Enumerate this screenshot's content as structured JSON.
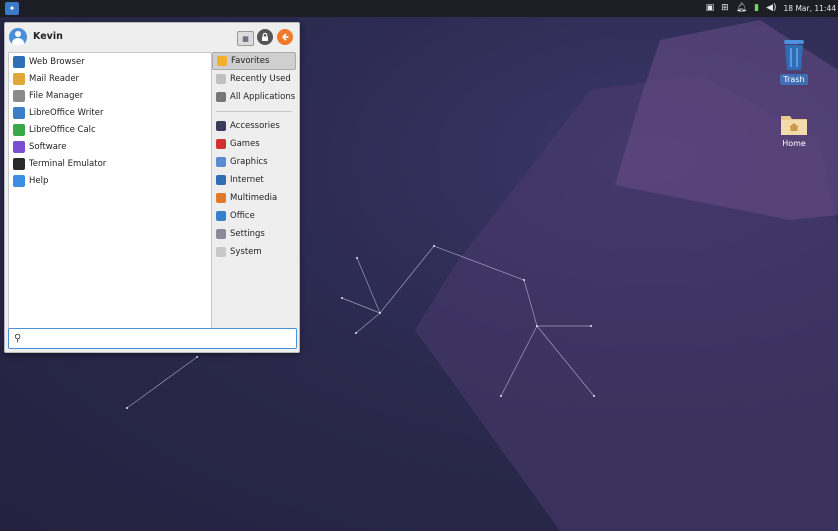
{
  "panel": {
    "clock": "18 Mar, 11:44"
  },
  "menu": {
    "username": "Kevin",
    "favorites": [
      {
        "label": "Web Browser",
        "icon": "globe-icon",
        "color": "#2f6db5"
      },
      {
        "label": "Mail Reader",
        "icon": "mail-icon",
        "color": "#e0a83a"
      },
      {
        "label": "File Manager",
        "icon": "folder-icon",
        "color": "#8a8a8a"
      },
      {
        "label": "LibreOffice Writer",
        "icon": "writer-icon",
        "color": "#3a7fc8"
      },
      {
        "label": "LibreOffice Calc",
        "icon": "calc-icon",
        "color": "#3aa84a"
      },
      {
        "label": "Software",
        "icon": "software-icon",
        "color": "#7b4fd1"
      },
      {
        "label": "Terminal Emulator",
        "icon": "terminal-icon",
        "color": "#2a2a2a"
      },
      {
        "label": "Help",
        "icon": "help-icon",
        "color": "#3a8fe0"
      }
    ],
    "categories_top": [
      {
        "label": "Favorites",
        "icon": "star-icon",
        "color": "#f0b030",
        "selected": true
      },
      {
        "label": "Recently Used",
        "icon": "clock-icon",
        "color": "#c0c0c0",
        "selected": false
      },
      {
        "label": "All Applications",
        "icon": "apps-icon",
        "color": "#777777",
        "selected": false
      }
    ],
    "categories": [
      {
        "label": "Accessories",
        "icon": "accessories-icon",
        "color": "#3a3a5a"
      },
      {
        "label": "Games",
        "icon": "games-icon",
        "color": "#d03030"
      },
      {
        "label": "Graphics",
        "icon": "graphics-icon",
        "color": "#5a8ad0"
      },
      {
        "label": "Internet",
        "icon": "internet-icon",
        "color": "#2f6db5"
      },
      {
        "label": "Multimedia",
        "icon": "multimedia-icon",
        "color": "#e07a2a"
      },
      {
        "label": "Office",
        "icon": "office-icon",
        "color": "#3a7fc8"
      },
      {
        "label": "Settings",
        "icon": "settings-icon",
        "color": "#8a8a9a"
      },
      {
        "label": "System",
        "icon": "system-icon",
        "color": "#c8c8c8"
      }
    ],
    "search_placeholder": ""
  },
  "desktop": {
    "trash_label": "Trash",
    "home_label": "Home"
  },
  "colors": {
    "panel": "#1d1d24",
    "accent": "#4a90d9",
    "desktop": "#2c2b4e"
  }
}
